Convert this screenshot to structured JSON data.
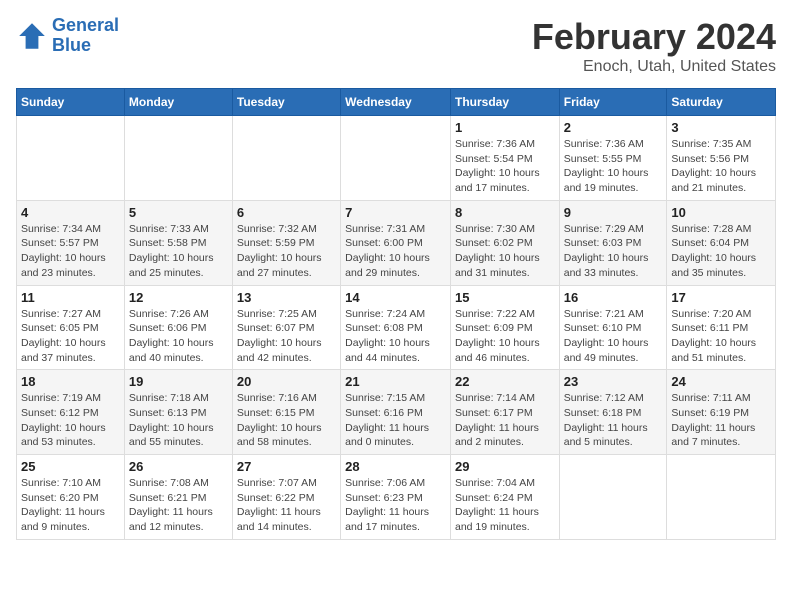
{
  "header": {
    "logo_line1": "General",
    "logo_line2": "Blue",
    "main_title": "February 2024",
    "subtitle": "Enoch, Utah, United States"
  },
  "days_of_week": [
    "Sunday",
    "Monday",
    "Tuesday",
    "Wednesday",
    "Thursday",
    "Friday",
    "Saturday"
  ],
  "weeks": [
    [
      {
        "num": "",
        "info": ""
      },
      {
        "num": "",
        "info": ""
      },
      {
        "num": "",
        "info": ""
      },
      {
        "num": "",
        "info": ""
      },
      {
        "num": "1",
        "info": "Sunrise: 7:36 AM\nSunset: 5:54 PM\nDaylight: 10 hours and 17 minutes."
      },
      {
        "num": "2",
        "info": "Sunrise: 7:36 AM\nSunset: 5:55 PM\nDaylight: 10 hours and 19 minutes."
      },
      {
        "num": "3",
        "info": "Sunrise: 7:35 AM\nSunset: 5:56 PM\nDaylight: 10 hours and 21 minutes."
      }
    ],
    [
      {
        "num": "4",
        "info": "Sunrise: 7:34 AM\nSunset: 5:57 PM\nDaylight: 10 hours and 23 minutes."
      },
      {
        "num": "5",
        "info": "Sunrise: 7:33 AM\nSunset: 5:58 PM\nDaylight: 10 hours and 25 minutes."
      },
      {
        "num": "6",
        "info": "Sunrise: 7:32 AM\nSunset: 5:59 PM\nDaylight: 10 hours and 27 minutes."
      },
      {
        "num": "7",
        "info": "Sunrise: 7:31 AM\nSunset: 6:00 PM\nDaylight: 10 hours and 29 minutes."
      },
      {
        "num": "8",
        "info": "Sunrise: 7:30 AM\nSunset: 6:02 PM\nDaylight: 10 hours and 31 minutes."
      },
      {
        "num": "9",
        "info": "Sunrise: 7:29 AM\nSunset: 6:03 PM\nDaylight: 10 hours and 33 minutes."
      },
      {
        "num": "10",
        "info": "Sunrise: 7:28 AM\nSunset: 6:04 PM\nDaylight: 10 hours and 35 minutes."
      }
    ],
    [
      {
        "num": "11",
        "info": "Sunrise: 7:27 AM\nSunset: 6:05 PM\nDaylight: 10 hours and 37 minutes."
      },
      {
        "num": "12",
        "info": "Sunrise: 7:26 AM\nSunset: 6:06 PM\nDaylight: 10 hours and 40 minutes."
      },
      {
        "num": "13",
        "info": "Sunrise: 7:25 AM\nSunset: 6:07 PM\nDaylight: 10 hours and 42 minutes."
      },
      {
        "num": "14",
        "info": "Sunrise: 7:24 AM\nSunset: 6:08 PM\nDaylight: 10 hours and 44 minutes."
      },
      {
        "num": "15",
        "info": "Sunrise: 7:22 AM\nSunset: 6:09 PM\nDaylight: 10 hours and 46 minutes."
      },
      {
        "num": "16",
        "info": "Sunrise: 7:21 AM\nSunset: 6:10 PM\nDaylight: 10 hours and 49 minutes."
      },
      {
        "num": "17",
        "info": "Sunrise: 7:20 AM\nSunset: 6:11 PM\nDaylight: 10 hours and 51 minutes."
      }
    ],
    [
      {
        "num": "18",
        "info": "Sunrise: 7:19 AM\nSunset: 6:12 PM\nDaylight: 10 hours and 53 minutes."
      },
      {
        "num": "19",
        "info": "Sunrise: 7:18 AM\nSunset: 6:13 PM\nDaylight: 10 hours and 55 minutes."
      },
      {
        "num": "20",
        "info": "Sunrise: 7:16 AM\nSunset: 6:15 PM\nDaylight: 10 hours and 58 minutes."
      },
      {
        "num": "21",
        "info": "Sunrise: 7:15 AM\nSunset: 6:16 PM\nDaylight: 11 hours and 0 minutes."
      },
      {
        "num": "22",
        "info": "Sunrise: 7:14 AM\nSunset: 6:17 PM\nDaylight: 11 hours and 2 minutes."
      },
      {
        "num": "23",
        "info": "Sunrise: 7:12 AM\nSunset: 6:18 PM\nDaylight: 11 hours and 5 minutes."
      },
      {
        "num": "24",
        "info": "Sunrise: 7:11 AM\nSunset: 6:19 PM\nDaylight: 11 hours and 7 minutes."
      }
    ],
    [
      {
        "num": "25",
        "info": "Sunrise: 7:10 AM\nSunset: 6:20 PM\nDaylight: 11 hours and 9 minutes."
      },
      {
        "num": "26",
        "info": "Sunrise: 7:08 AM\nSunset: 6:21 PM\nDaylight: 11 hours and 12 minutes."
      },
      {
        "num": "27",
        "info": "Sunrise: 7:07 AM\nSunset: 6:22 PM\nDaylight: 11 hours and 14 minutes."
      },
      {
        "num": "28",
        "info": "Sunrise: 7:06 AM\nSunset: 6:23 PM\nDaylight: 11 hours and 17 minutes."
      },
      {
        "num": "29",
        "info": "Sunrise: 7:04 AM\nSunset: 6:24 PM\nDaylight: 11 hours and 19 minutes."
      },
      {
        "num": "",
        "info": ""
      },
      {
        "num": "",
        "info": ""
      }
    ]
  ]
}
